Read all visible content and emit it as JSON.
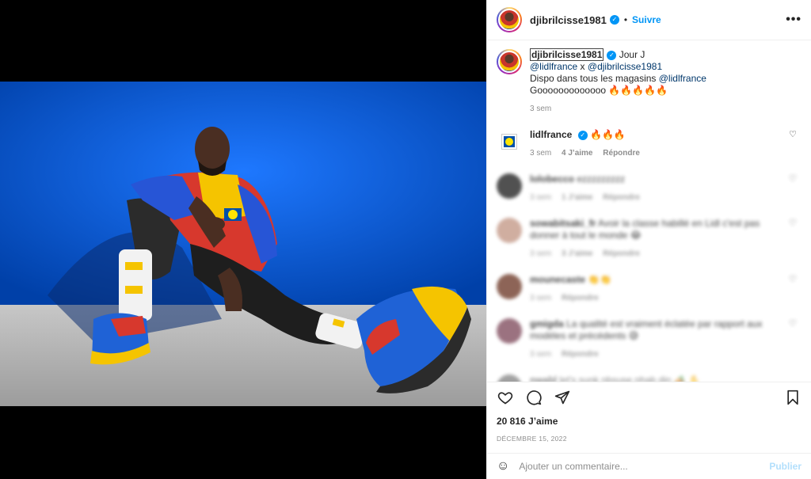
{
  "post": {
    "username": "djibrilcisse1981",
    "follow_label": "Suivre",
    "dot": "•",
    "more": "•••"
  },
  "caption": {
    "username": "djibrilcisse1981",
    "line1": "Jour J",
    "mention1": "@lidlfrance",
    "x": " x ",
    "mention2": "@djibrilcisse1981",
    "line3": "Dispo dans tous les magasins ",
    "mention3": "@lidlfrance",
    "line4": "Gooooooooooooo 🔥🔥🔥🔥🔥",
    "time": "3 sem"
  },
  "comments": [
    {
      "user": "lidlfrance",
      "text": "🔥🔥🔥",
      "time": "3 sem",
      "likes": "4 J’aime",
      "reply": "Répondre",
      "blurred": false
    },
    {
      "user": "lolobecco",
      "text": "ezzzzzzzzz",
      "time": "3 sem",
      "likes": "1 J’aime",
      "reply": "Répondre",
      "blurred": true
    },
    {
      "user": "sowabitsaki_fr",
      "text": "Avoir la classe habillé en Lidl c'est pas donner à tout le monde 😂",
      "time": "3 sem",
      "likes": "3 J’aime",
      "reply": "Répondre",
      "blurred": true
    },
    {
      "user": "mounecaste",
      "text": "👏👏",
      "time": "3 sem",
      "likes": "",
      "reply": "Répondre",
      "blurred": true
    },
    {
      "user": "gmigda",
      "text": "La qualité est vraiment éclatée par rapport aux modèles et précédents 😅",
      "time": "3 sem",
      "likes": "",
      "reply": "Répondre",
      "blurred": true
    },
    {
      "user": "nwabl",
      "text": "let's sunk nbsuse nhab din 🏕️ ✋",
      "time": "",
      "likes": "",
      "reply": "",
      "blurred": true
    }
  ],
  "likes_count": "20 816 J’aime",
  "date": "DÉCEMBRE 15, 2022",
  "add_comment": {
    "placeholder": "Ajouter un commentaire...",
    "publish": "Publier",
    "emoji": "☺"
  },
  "icons": {
    "like": "heart-icon",
    "comment": "comment-icon",
    "share": "share-icon",
    "save": "bookmark-icon"
  },
  "colors": {
    "accent": "#0095f6",
    "publish_disabled": "#b2dffc",
    "photo_bg": "#0057d8"
  }
}
